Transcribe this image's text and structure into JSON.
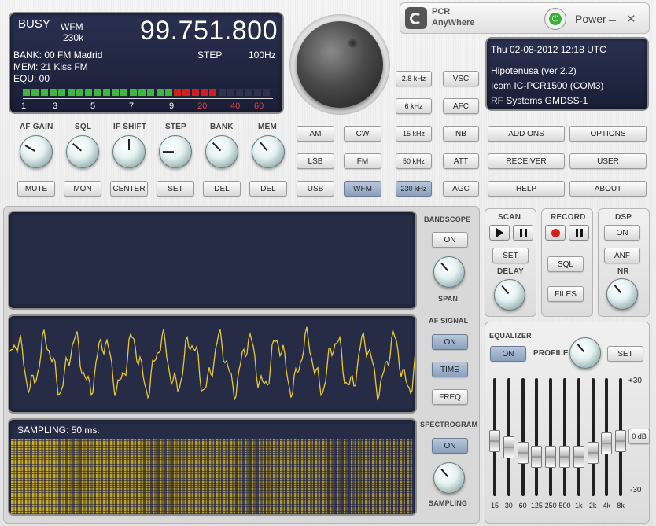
{
  "logo": {
    "line1": "PCR",
    "line2": "AnyWhere"
  },
  "window": {
    "power_label": "Power",
    "minimize": "_",
    "close": "✕"
  },
  "display": {
    "busy": "BUSY",
    "mode": "WFM",
    "bandwidth": "230k",
    "frequency": "99.751.800",
    "bank": "BANK: 00 FM Madrid",
    "mem": "MEM:  21 Kiss FM",
    "equ": "EQU:  00",
    "step_label": "STEP",
    "step_value": "100Hz",
    "meter_scale": [
      "1",
      "3",
      "5",
      "7",
      "9",
      "20",
      "40",
      "60"
    ],
    "meter_level_green": 17,
    "meter_level_red": 5
  },
  "info": {
    "datetime": "Thu 02-08-2012 12:18 UTC",
    "line1": "Hipotenusa (ver 2.2)",
    "line2": "Icom IC-PCR1500 (COM3)",
    "line3": "RF Systems GMDSS-1"
  },
  "knob_labels": [
    "AF GAIN",
    "SQL",
    "IF SHIFT",
    "STEP",
    "BANK",
    "MEM"
  ],
  "knob_buttons": [
    "MUTE",
    "MON",
    "CENTER",
    "SET",
    "DEL",
    "DEL"
  ],
  "modes": [
    "AM",
    "CW",
    "LSB",
    "FM",
    "USB",
    "WFM"
  ],
  "active_mode": "WFM",
  "filters": [
    "2.8 kHz",
    "6 kHz",
    "15 kHz",
    "50 kHz",
    "230 kHz"
  ],
  "active_filter": "230 kHz",
  "functions": [
    "VSC",
    "AFC",
    "NB",
    "ATT",
    "AGC"
  ],
  "right_buttons": [
    "ADD ONS",
    "OPTIONS",
    "RECEIVER",
    "USER",
    "HELP",
    "ABOUT"
  ],
  "bandscope": {
    "title": "BANDSCOPE",
    "on": "ON",
    "span": "SPAN"
  },
  "afsignal": {
    "title": "AF SIGNAL",
    "on": "ON",
    "time": "TIME",
    "freq": "FREQ"
  },
  "spectrogram": {
    "title": "SPECTROGRAM",
    "on": "ON",
    "sampling": "SAMPLING",
    "sampling_text": "SAMPLING: 50 ms."
  },
  "scan": {
    "title": "SCAN",
    "set": "SET",
    "delay": "DELAY"
  },
  "record": {
    "title": "RECORD",
    "sql": "SQL",
    "files": "FILES"
  },
  "dsp": {
    "title": "DSP",
    "on": "ON",
    "anf": "ANF",
    "nr": "NR"
  },
  "equalizer": {
    "title": "EQUALIZER",
    "on": "ON",
    "profile": "PROFILE",
    "set": "SET",
    "top": "+30",
    "mid": "0 dB",
    "bottom": "-30",
    "bands": [
      "15",
      "30",
      "60",
      "125",
      "250",
      "500",
      "1k",
      "2k",
      "4k",
      "8k"
    ],
    "levels": [
      -2,
      -5,
      -8,
      -10,
      -10,
      -10,
      -10,
      -8,
      -3,
      -2
    ]
  }
}
